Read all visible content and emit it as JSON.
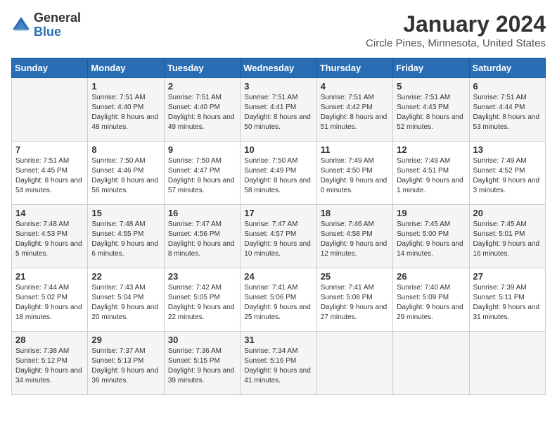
{
  "logo": {
    "general": "General",
    "blue": "Blue"
  },
  "title": "January 2024",
  "location": "Circle Pines, Minnesota, United States",
  "days_header": [
    "Sunday",
    "Monday",
    "Tuesday",
    "Wednesday",
    "Thursday",
    "Friday",
    "Saturday"
  ],
  "weeks": [
    [
      {
        "day": "",
        "sunrise": "",
        "sunset": "",
        "daylight": ""
      },
      {
        "day": "1",
        "sunrise": "Sunrise: 7:51 AM",
        "sunset": "Sunset: 4:40 PM",
        "daylight": "Daylight: 8 hours and 48 minutes."
      },
      {
        "day": "2",
        "sunrise": "Sunrise: 7:51 AM",
        "sunset": "Sunset: 4:40 PM",
        "daylight": "Daylight: 8 hours and 49 minutes."
      },
      {
        "day": "3",
        "sunrise": "Sunrise: 7:51 AM",
        "sunset": "Sunset: 4:41 PM",
        "daylight": "Daylight: 8 hours and 50 minutes."
      },
      {
        "day": "4",
        "sunrise": "Sunrise: 7:51 AM",
        "sunset": "Sunset: 4:42 PM",
        "daylight": "Daylight: 8 hours and 51 minutes."
      },
      {
        "day": "5",
        "sunrise": "Sunrise: 7:51 AM",
        "sunset": "Sunset: 4:43 PM",
        "daylight": "Daylight: 8 hours and 52 minutes."
      },
      {
        "day": "6",
        "sunrise": "Sunrise: 7:51 AM",
        "sunset": "Sunset: 4:44 PM",
        "daylight": "Daylight: 8 hours and 53 minutes."
      }
    ],
    [
      {
        "day": "7",
        "sunrise": "Sunrise: 7:51 AM",
        "sunset": "Sunset: 4:45 PM",
        "daylight": "Daylight: 8 hours and 54 minutes."
      },
      {
        "day": "8",
        "sunrise": "Sunrise: 7:50 AM",
        "sunset": "Sunset: 4:46 PM",
        "daylight": "Daylight: 8 hours and 56 minutes."
      },
      {
        "day": "9",
        "sunrise": "Sunrise: 7:50 AM",
        "sunset": "Sunset: 4:47 PM",
        "daylight": "Daylight: 8 hours and 57 minutes."
      },
      {
        "day": "10",
        "sunrise": "Sunrise: 7:50 AM",
        "sunset": "Sunset: 4:49 PM",
        "daylight": "Daylight: 8 hours and 58 minutes."
      },
      {
        "day": "11",
        "sunrise": "Sunrise: 7:49 AM",
        "sunset": "Sunset: 4:50 PM",
        "daylight": "Daylight: 9 hours and 0 minutes."
      },
      {
        "day": "12",
        "sunrise": "Sunrise: 7:49 AM",
        "sunset": "Sunset: 4:51 PM",
        "daylight": "Daylight: 9 hours and 1 minute."
      },
      {
        "day": "13",
        "sunrise": "Sunrise: 7:49 AM",
        "sunset": "Sunset: 4:52 PM",
        "daylight": "Daylight: 9 hours and 3 minutes."
      }
    ],
    [
      {
        "day": "14",
        "sunrise": "Sunrise: 7:48 AM",
        "sunset": "Sunset: 4:53 PM",
        "daylight": "Daylight: 9 hours and 5 minutes."
      },
      {
        "day": "15",
        "sunrise": "Sunrise: 7:48 AM",
        "sunset": "Sunset: 4:55 PM",
        "daylight": "Daylight: 9 hours and 6 minutes."
      },
      {
        "day": "16",
        "sunrise": "Sunrise: 7:47 AM",
        "sunset": "Sunset: 4:56 PM",
        "daylight": "Daylight: 9 hours and 8 minutes."
      },
      {
        "day": "17",
        "sunrise": "Sunrise: 7:47 AM",
        "sunset": "Sunset: 4:57 PM",
        "daylight": "Daylight: 9 hours and 10 minutes."
      },
      {
        "day": "18",
        "sunrise": "Sunrise: 7:46 AM",
        "sunset": "Sunset: 4:58 PM",
        "daylight": "Daylight: 9 hours and 12 minutes."
      },
      {
        "day": "19",
        "sunrise": "Sunrise: 7:45 AM",
        "sunset": "Sunset: 5:00 PM",
        "daylight": "Daylight: 9 hours and 14 minutes."
      },
      {
        "day": "20",
        "sunrise": "Sunrise: 7:45 AM",
        "sunset": "Sunset: 5:01 PM",
        "daylight": "Daylight: 9 hours and 16 minutes."
      }
    ],
    [
      {
        "day": "21",
        "sunrise": "Sunrise: 7:44 AM",
        "sunset": "Sunset: 5:02 PM",
        "daylight": "Daylight: 9 hours and 18 minutes."
      },
      {
        "day": "22",
        "sunrise": "Sunrise: 7:43 AM",
        "sunset": "Sunset: 5:04 PM",
        "daylight": "Daylight: 9 hours and 20 minutes."
      },
      {
        "day": "23",
        "sunrise": "Sunrise: 7:42 AM",
        "sunset": "Sunset: 5:05 PM",
        "daylight": "Daylight: 9 hours and 22 minutes."
      },
      {
        "day": "24",
        "sunrise": "Sunrise: 7:41 AM",
        "sunset": "Sunset: 5:06 PM",
        "daylight": "Daylight: 9 hours and 25 minutes."
      },
      {
        "day": "25",
        "sunrise": "Sunrise: 7:41 AM",
        "sunset": "Sunset: 5:08 PM",
        "daylight": "Daylight: 9 hours and 27 minutes."
      },
      {
        "day": "26",
        "sunrise": "Sunrise: 7:40 AM",
        "sunset": "Sunset: 5:09 PM",
        "daylight": "Daylight: 9 hours and 29 minutes."
      },
      {
        "day": "27",
        "sunrise": "Sunrise: 7:39 AM",
        "sunset": "Sunset: 5:11 PM",
        "daylight": "Daylight: 9 hours and 31 minutes."
      }
    ],
    [
      {
        "day": "28",
        "sunrise": "Sunrise: 7:38 AM",
        "sunset": "Sunset: 5:12 PM",
        "daylight": "Daylight: 9 hours and 34 minutes."
      },
      {
        "day": "29",
        "sunrise": "Sunrise: 7:37 AM",
        "sunset": "Sunset: 5:13 PM",
        "daylight": "Daylight: 9 hours and 36 minutes."
      },
      {
        "day": "30",
        "sunrise": "Sunrise: 7:36 AM",
        "sunset": "Sunset: 5:15 PM",
        "daylight": "Daylight: 9 hours and 39 minutes."
      },
      {
        "day": "31",
        "sunrise": "Sunrise: 7:34 AM",
        "sunset": "Sunset: 5:16 PM",
        "daylight": "Daylight: 9 hours and 41 minutes."
      },
      {
        "day": "",
        "sunrise": "",
        "sunset": "",
        "daylight": ""
      },
      {
        "day": "",
        "sunrise": "",
        "sunset": "",
        "daylight": ""
      },
      {
        "day": "",
        "sunrise": "",
        "sunset": "",
        "daylight": ""
      }
    ]
  ]
}
